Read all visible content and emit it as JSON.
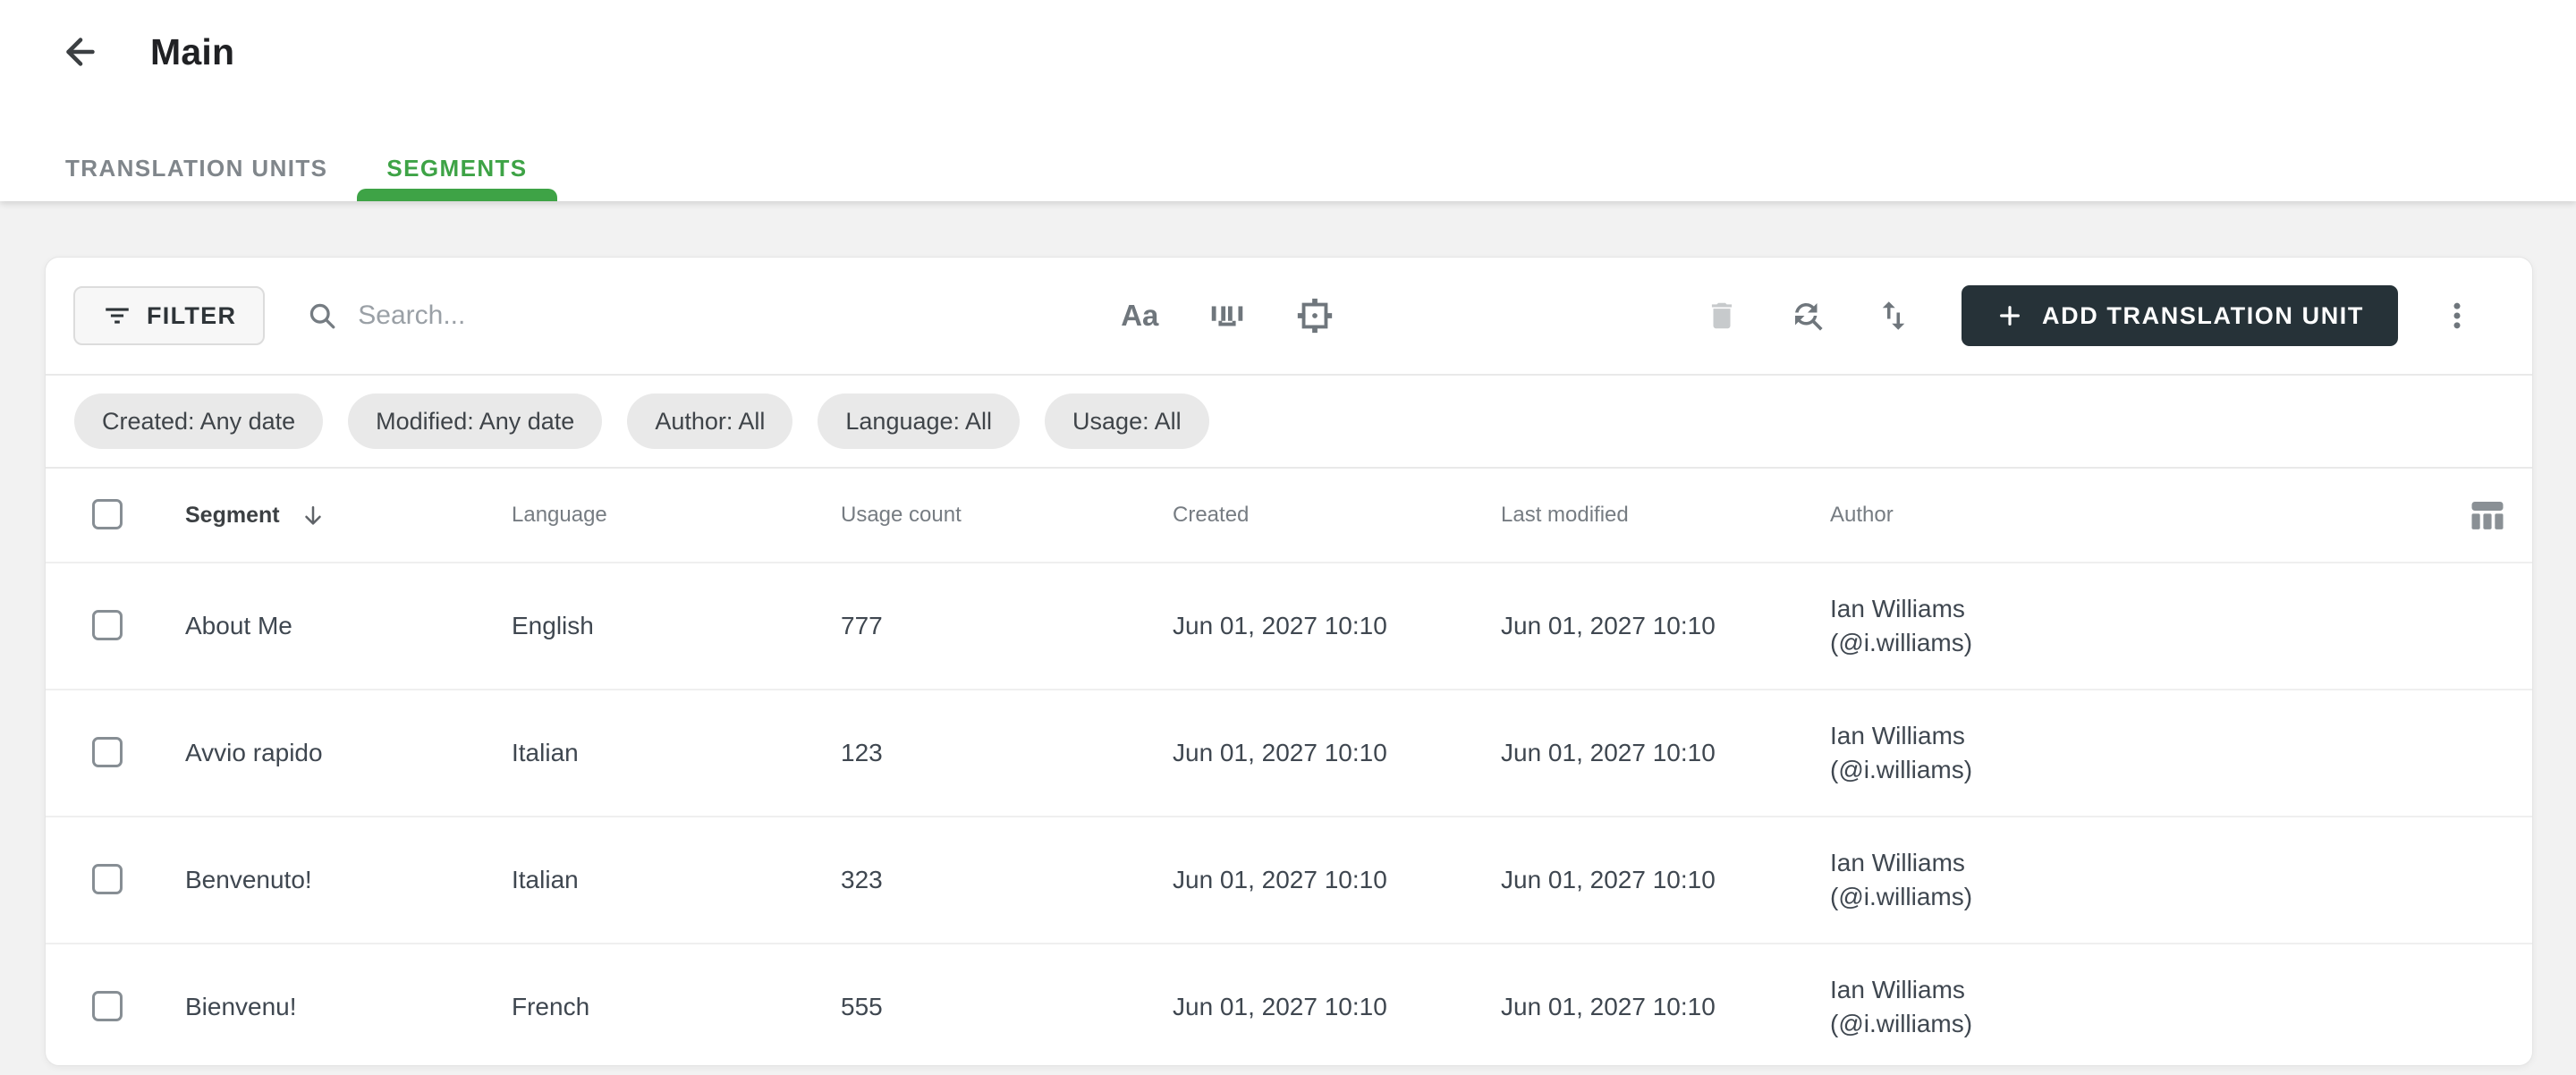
{
  "colors": {
    "accent-green": "#3EA346",
    "dark-button-bg": "#263238",
    "page-bg": "#F2F2F2",
    "chip-bg": "#E9E9E9"
  },
  "header": {
    "title": "Main",
    "tabs": [
      {
        "label": "TRANSLATION UNITS",
        "active": false
      },
      {
        "label": "SEGMENTS",
        "active": true
      }
    ]
  },
  "toolbar": {
    "filter_label": "FILTER",
    "search_placeholder": "Search...",
    "match_case_label": "Aa",
    "add_button_label": "ADD TRANSLATION UNIT"
  },
  "filters": {
    "chips": [
      "Created: Any date",
      "Modified: Any date",
      "Author: All",
      "Language: All",
      "Usage: All"
    ]
  },
  "table": {
    "columns": [
      "Segment",
      "Language",
      "Usage count",
      "Created",
      "Last modified",
      "Author"
    ],
    "sort_column": "Segment",
    "sort_direction": "desc",
    "rows": [
      {
        "segment": "About Me",
        "language": "English",
        "usage_count": "777",
        "created": "Jun 01, 2027 10:10",
        "last_modified": "Jun 01, 2027 10:10",
        "author_name": "Ian Williams",
        "author_handle": "(@i.williams)"
      },
      {
        "segment": "Avvio rapido",
        "language": "Italian",
        "usage_count": "123",
        "created": "Jun 01, 2027 10:10",
        "last_modified": "Jun 01, 2027 10:10",
        "author_name": "Ian Williams",
        "author_handle": "(@i.williams)"
      },
      {
        "segment": "Benvenuto!",
        "language": "Italian",
        "usage_count": "323",
        "created": "Jun 01, 2027 10:10",
        "last_modified": "Jun 01, 2027 10:10",
        "author_name": "Ian Williams",
        "author_handle": "(@i.williams)"
      },
      {
        "segment": "Bienvenu!",
        "language": "French",
        "usage_count": "555",
        "created": "Jun 01, 2027 10:10",
        "last_modified": "Jun 01, 2027 10:10",
        "author_name": "Ian Williams",
        "author_handle": "(@i.williams)"
      }
    ]
  }
}
